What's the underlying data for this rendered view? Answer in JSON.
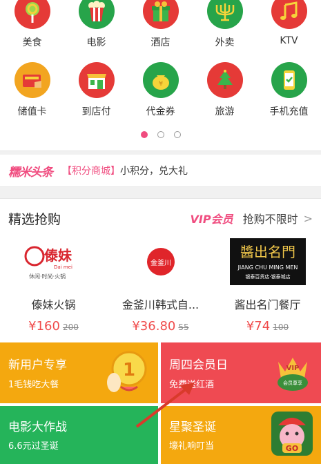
{
  "categories": [
    {
      "label": "美食",
      "icon": "lollipop-icon",
      "color": "#e53a37"
    },
    {
      "label": "电影",
      "icon": "popcorn-icon",
      "color": "#27a44a"
    },
    {
      "label": "酒店",
      "icon": "gift-box-icon",
      "color": "#e53a37"
    },
    {
      "label": "外卖",
      "icon": "candelabra-icon",
      "color": "#27a44a"
    },
    {
      "label": "KTV",
      "icon": "music-note-icon",
      "color": "#e53a37"
    },
    {
      "label": "储值卡",
      "icon": "stored-card-icon",
      "color": "#27a44a"
    },
    {
      "label": "到店付",
      "icon": "storefront-icon",
      "color": "#e53a37"
    },
    {
      "label": "代金券",
      "icon": "money-bag-icon",
      "color": "#27a44a"
    },
    {
      "label": "旅游",
      "icon": "christmas-tree-icon",
      "color": "#e53a37"
    },
    {
      "label": "手机充值",
      "icon": "phone-check-icon",
      "color": "#27a44a"
    }
  ],
  "pager": {
    "count": 3,
    "active": 0
  },
  "ticker": {
    "logo": "糯米头条",
    "tag": "【积分商城】",
    "text": "小积分，兑大礼"
  },
  "sale": {
    "title": "精选抢购",
    "vip_mark": "VIP会员",
    "more": "抢购不限时",
    "items": [
      {
        "name": "傣妹火锅",
        "price": "¥160",
        "old_price": "200",
        "logo_text": "傣妹",
        "logo_sub": "Dai mei",
        "logo_tag": "休闲·时尚·火锅"
      },
      {
        "name": "金釜川韩式自...",
        "price": "¥36.80",
        "old_price": "55",
        "logo_text": "金釜川"
      },
      {
        "name": "酱出名门餐厅",
        "price": "¥74",
        "old_price": "100",
        "logo_text": "醬出名門",
        "logo_sub": "JIANG CHU MING MEN",
        "logo_tag": "银泰百货店·银泰城店"
      }
    ]
  },
  "tiles": [
    {
      "title": "新用户专享",
      "sub": "1毛钱吃大餐",
      "color": "#f4a80f"
    },
    {
      "title": "周四会员日",
      "sub": "免费送红酒",
      "color": "#ef4a52",
      "badge": "VIP",
      "badge_sub": "会员尊享"
    },
    {
      "title": "电影大作战",
      "sub": "6.6元过圣诞",
      "color": "#25b45a"
    },
    {
      "title": "星聚圣诞",
      "sub": "壕礼响叮当",
      "color": "#f4a80f",
      "badge": "GO"
    }
  ]
}
